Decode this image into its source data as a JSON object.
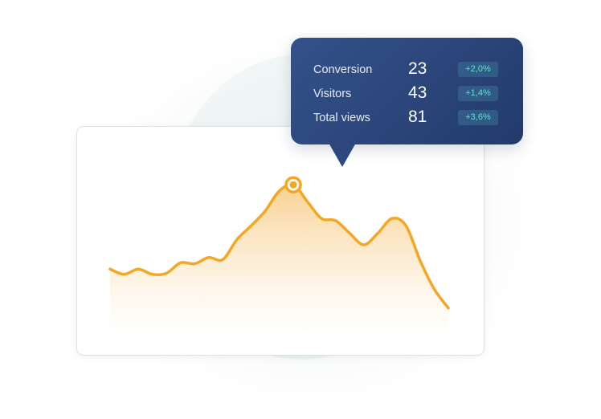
{
  "tooltip": {
    "rows": [
      {
        "label": "Conversion",
        "value": "23",
        "change": "+2,0%"
      },
      {
        "label": "Visitors",
        "value": "43",
        "change": "+1,4%"
      },
      {
        "label": "Total views",
        "value": "81",
        "change": "+3,6%"
      }
    ]
  },
  "colors": {
    "line": "#f5a623",
    "area_top": "#f7c97e",
    "tooltip_bg": "#2a4478",
    "badge_text": "#5fe3d3"
  },
  "chart_data": {
    "type": "area",
    "title": "",
    "xlabel": "",
    "ylabel": "",
    "grid": false,
    "legend": "none",
    "x": [
      0,
      1,
      2,
      3,
      4,
      5,
      6,
      7,
      8,
      9,
      10,
      11,
      12,
      13,
      14,
      15,
      16,
      17,
      18,
      19,
      20,
      21,
      22,
      23,
      24
    ],
    "values": [
      37,
      32,
      37,
      32,
      33,
      43,
      42,
      48,
      46,
      65,
      78,
      92,
      111,
      117,
      101,
      85,
      83,
      71,
      60,
      71,
      85,
      78,
      45,
      18,
      0
    ],
    "ylim": [
      -20,
      140
    ],
    "highlight": {
      "index": 13,
      "label": "peak"
    }
  }
}
